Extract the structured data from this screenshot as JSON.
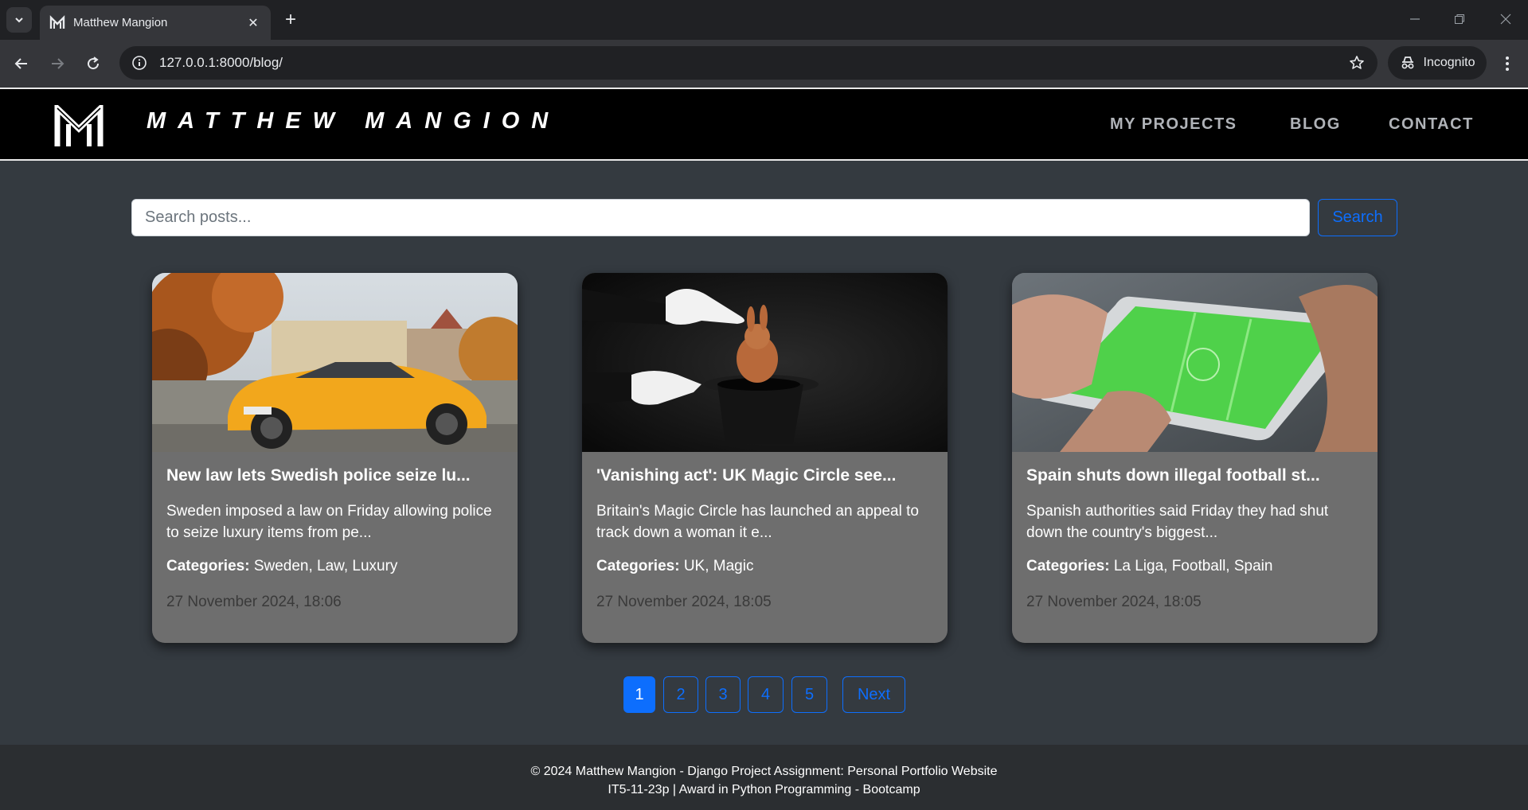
{
  "browser": {
    "tab_title": "Matthew Mangion",
    "url": "127.0.0.1:8000/blog/",
    "incognito_label": "Incognito"
  },
  "header": {
    "brand": "MATTHEW MANGION",
    "nav": [
      "MY PROJECTS",
      "BLOG",
      "CONTACT"
    ]
  },
  "search": {
    "placeholder": "Search posts...",
    "button_label": "Search"
  },
  "posts": [
    {
      "title": "New law lets Swedish police seize lu...",
      "excerpt": "Sweden imposed a law on Friday allowing police to seize luxury items from pe...",
      "categories_label": "Categories:",
      "categories": "Sweden, Law, Luxury",
      "date": "27 November 2024, 18:06"
    },
    {
      "title": "'Vanishing act': UK Magic Circle see...",
      "excerpt": "Britain's Magic Circle has launched an appeal to track down a woman it e...",
      "categories_label": "Categories:",
      "categories": "UK, Magic",
      "date": "27 November 2024, 18:05"
    },
    {
      "title": "Spain shuts down illegal football st...",
      "excerpt": "Spanish authorities said Friday they had shut down the country's biggest...",
      "categories_label": "Categories:",
      "categories": "La Liga, Football, Spain",
      "date": "27 November 2024, 18:05"
    }
  ],
  "pagination": {
    "pages": [
      "1",
      "2",
      "3",
      "4",
      "5"
    ],
    "current": "1",
    "next_label": "Next"
  },
  "footer": {
    "line1": "© 2024 Matthew Mangion - Django Project Assignment: Personal Portfolio Website",
    "line2": "IT5-11-23p | Award in Python Programming - Bootcamp"
  },
  "colors": {
    "accent": "#0d6efd",
    "page_bg": "#343a40",
    "card_bg": "#6e6e6e",
    "header_bg": "#000000"
  }
}
